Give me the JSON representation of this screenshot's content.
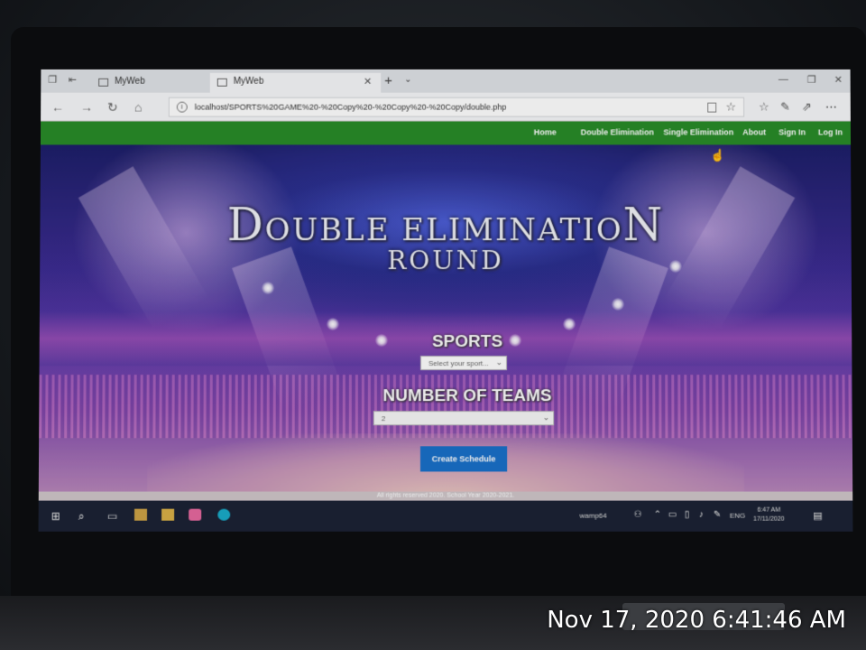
{
  "browser": {
    "tabs": [
      {
        "label": "MyWeb",
        "active": false
      },
      {
        "label": "MyWeb",
        "active": true
      }
    ],
    "new_tab": "+",
    "tab_menu": "⌄",
    "url": "localhost/SPORTS%20GAME%20-%20Copy%20-%20Copy%20-%20Copy/double.php"
  },
  "nav": {
    "links": [
      "Home",
      "Double Elimination",
      "Single Elimination",
      "About",
      "Sign In",
      "Log In"
    ]
  },
  "hero": {
    "title_line1_cap1": "D",
    "title_line1_body": "OUBLE ELIMINATIO",
    "title_line1_cap2": "N",
    "title_line2": "ROUND"
  },
  "form": {
    "sports_label": "SPORTS",
    "sports_placeholder": "Select your sport...",
    "teams_label": "NUMBER OF TEAMS",
    "teams_value": "2",
    "create_button": "Create Schedule"
  },
  "footer": {
    "text": "All rights reserved 2020. School Year 2020-2021."
  },
  "taskbar": {
    "app_label": "wamp64",
    "language": "ENG",
    "time": "6:47 AM",
    "date": "17/11/2020"
  },
  "photo_timestamp": "Nov 17, 2020 6:41:46 AM",
  "colors": {
    "nav_bg": "#2c8a2c",
    "button_bg": "#1d6fc4",
    "taskbar_bg": "#1b2233"
  }
}
